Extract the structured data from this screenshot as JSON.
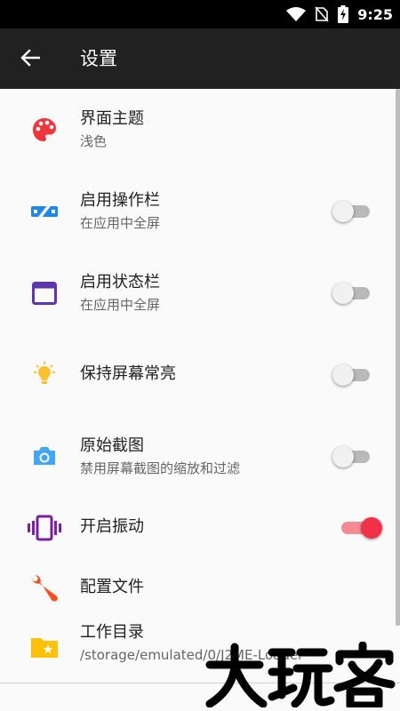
{
  "status_bar": {
    "time": "9:25"
  },
  "app_bar": {
    "title": "设置"
  },
  "items": [
    {
      "title": "界面主题",
      "subtitle": "浅色"
    },
    {
      "title": "启用操作栏",
      "subtitle": "在应用中全屏",
      "toggle": false
    },
    {
      "title": "启用状态栏",
      "subtitle": "在应用中全屏",
      "toggle": false
    },
    {
      "title": "保持屏幕常亮",
      "toggle": false
    },
    {
      "title": "原始截图",
      "subtitle": "禁用屏幕截图的缩放和过滤",
      "toggle": false
    },
    {
      "title": "开启振动",
      "toggle": true
    },
    {
      "title": "配置文件"
    },
    {
      "title": "工作目录",
      "subtitle": "/storage/emulated/0/J2ME-Loader"
    }
  ],
  "watermark": {
    "text": "大玩客"
  },
  "colors": {
    "accent": "#f23047",
    "palette_icon": "#f1353d",
    "actionbar_icon": "#1e88e5",
    "statusbar_icon": "#5e35b1",
    "bulb_icon": "#fbc02d",
    "camera_icon": "#42a5f5",
    "vibrate_icon": "#7b1fa2",
    "wrench_icon": "#f4511e",
    "folder_icon": "#ffc107"
  }
}
